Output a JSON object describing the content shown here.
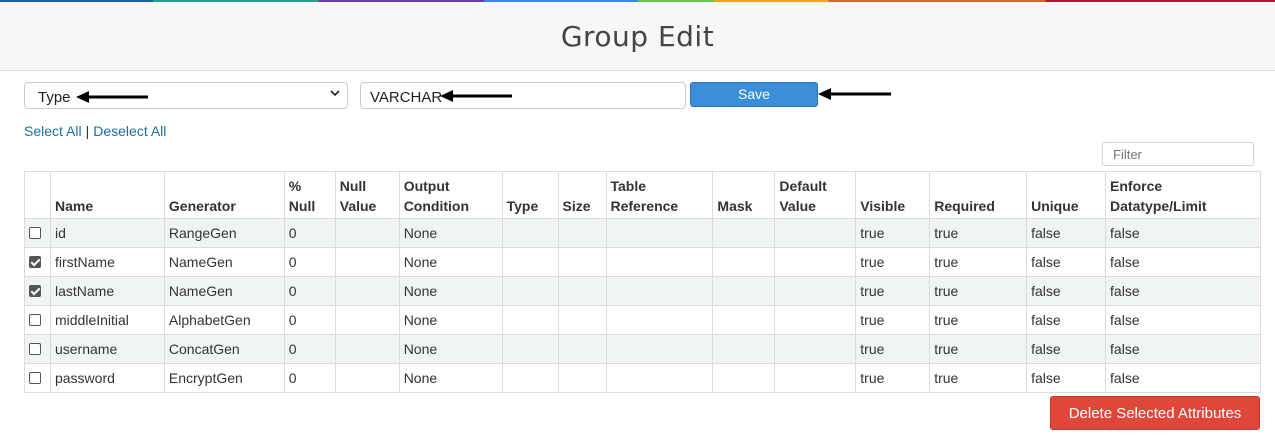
{
  "header": {
    "title": "Group Edit"
  },
  "toolbar": {
    "attribute_select": {
      "selected": "Type"
    },
    "value_input": {
      "value": "VARCHAR"
    },
    "save_label": "Save"
  },
  "selection_links": {
    "select_all": "Select All",
    "separator": "|",
    "deselect_all": "Deselect All"
  },
  "filter": {
    "placeholder": "Filter"
  },
  "table": {
    "columns": [
      "",
      "Name",
      "Generator",
      "% Null",
      "Null Value",
      "Output Condition",
      "Type",
      "Size",
      "Table Reference",
      "Mask",
      "Default Value",
      "Visible",
      "Required",
      "Unique",
      "Enforce Datatype/Limit"
    ],
    "rows": [
      {
        "checked": false,
        "name": "id",
        "generator": "RangeGen",
        "null_pct": "0",
        "null_value": "",
        "output_condition": "None",
        "type": "",
        "size": "",
        "table_reference": "",
        "mask": "",
        "default_value": "",
        "visible": "true",
        "required": "true",
        "unique": "false",
        "enforce": "false"
      },
      {
        "checked": true,
        "name": "firstName",
        "generator": "NameGen",
        "null_pct": "0",
        "null_value": "",
        "output_condition": "None",
        "type": "",
        "size": "",
        "table_reference": "",
        "mask": "",
        "default_value": "",
        "visible": "true",
        "required": "true",
        "unique": "false",
        "enforce": "false"
      },
      {
        "checked": true,
        "name": "lastName",
        "generator": "NameGen",
        "null_pct": "0",
        "null_value": "",
        "output_condition": "None",
        "type": "",
        "size": "",
        "table_reference": "",
        "mask": "",
        "default_value": "",
        "visible": "true",
        "required": "true",
        "unique": "false",
        "enforce": "false"
      },
      {
        "checked": false,
        "name": "middleInitial",
        "generator": "AlphabetGen",
        "null_pct": "0",
        "null_value": "",
        "output_condition": "None",
        "type": "",
        "size": "",
        "table_reference": "",
        "mask": "",
        "default_value": "",
        "visible": "true",
        "required": "true",
        "unique": "false",
        "enforce": "false"
      },
      {
        "checked": false,
        "name": "username",
        "generator": "ConcatGen",
        "null_pct": "0",
        "null_value": "",
        "output_condition": "None",
        "type": "",
        "size": "",
        "table_reference": "",
        "mask": "",
        "default_value": "",
        "visible": "true",
        "required": "true",
        "unique": "false",
        "enforce": "false"
      },
      {
        "checked": false,
        "name": "password",
        "generator": "EncryptGen",
        "null_pct": "0",
        "null_value": "",
        "output_condition": "None",
        "type": "",
        "size": "",
        "table_reference": "",
        "mask": "",
        "default_value": "",
        "visible": "true",
        "required": "true",
        "unique": "false",
        "enforce": "false"
      }
    ]
  },
  "delete_label": "Delete Selected Attributes",
  "colors": {
    "save": "#3a8ed8",
    "delete": "#e0473a",
    "link": "#1a6fa8",
    "row_stripe": "#f1f5f2"
  }
}
